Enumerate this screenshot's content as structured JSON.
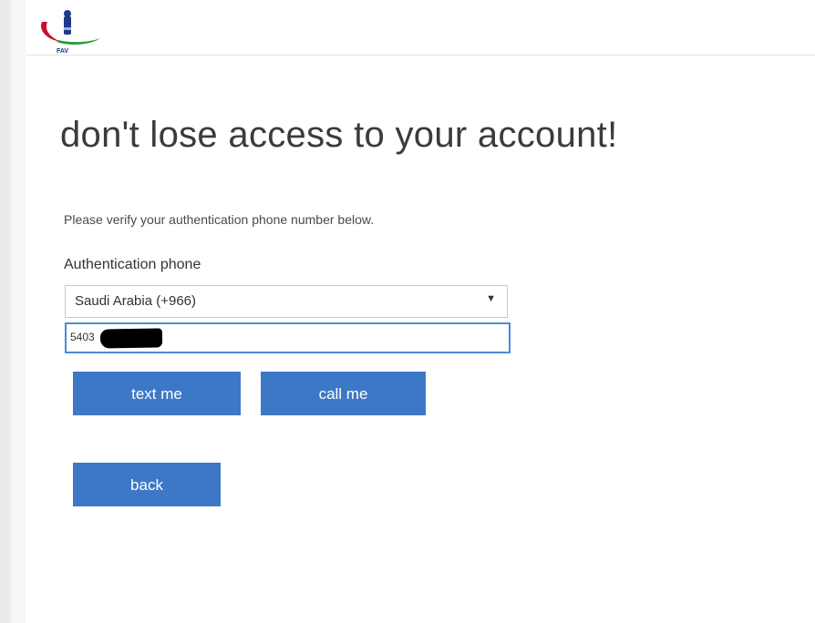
{
  "header": {
    "logo_text": "FAV"
  },
  "main": {
    "title": "don't lose access to your account!",
    "intro": "Please verify your authentication phone number below.",
    "phone_label": "Authentication phone",
    "country_select": {
      "value": "Saudi Arabia (+966)",
      "chevron": "▼"
    },
    "phone_input": {
      "value": "5403"
    },
    "buttons": {
      "text_me": "text me",
      "call_me": "call me",
      "back": "back"
    }
  },
  "colors": {
    "button_blue": "#3d78c6",
    "input_focus_border": "#4b8bd4",
    "logo_red": "#c8102e",
    "logo_green": "#2e9a3a",
    "logo_navy": "#1d3a8a"
  },
  "icons": {
    "logo": "organization-logo-icon",
    "select_arrow": "chevron-down-icon"
  }
}
